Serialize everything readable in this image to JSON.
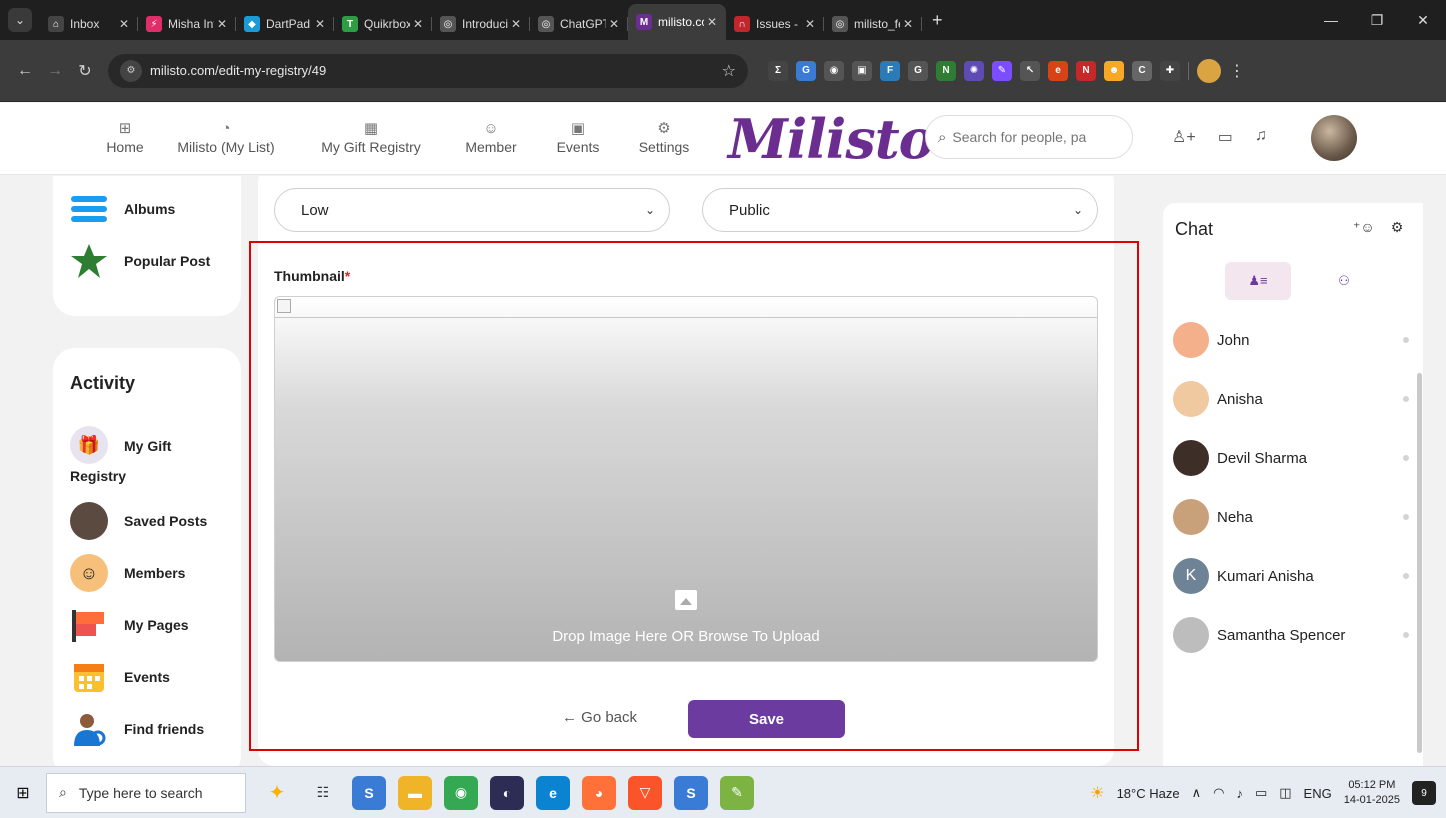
{
  "browser": {
    "tabs": [
      {
        "label": "Inbox",
        "icon": "inbox-icon",
        "color": "#444444",
        "glyph": "⌂"
      },
      {
        "label": "Misha Inf",
        "icon": "misha-icon",
        "color": "#e02e6a",
        "glyph": "⚡"
      },
      {
        "label": "DartPad",
        "icon": "dartpad-icon",
        "color": "#1a9ad6",
        "glyph": "◆"
      },
      {
        "label": "Quikrbox",
        "icon": "quikrbox-icon",
        "color": "#2e9e44",
        "glyph": "T"
      },
      {
        "label": "Introducir",
        "icon": "openai-icon",
        "color": "#555555",
        "glyph": "◎"
      },
      {
        "label": "ChatGPT",
        "icon": "chatgpt-icon",
        "color": "#555555",
        "glyph": "◎"
      },
      {
        "label": "milisto.co",
        "icon": "milisto-icon",
        "color": "#6b2d8f",
        "glyph": "M",
        "active": true
      },
      {
        "label": "Issues - M",
        "icon": "issues-icon",
        "color": "#c0262d",
        "glyph": "∩"
      },
      {
        "label": "milisto_fe",
        "icon": "github-icon",
        "color": "#555555",
        "glyph": "◎"
      }
    ],
    "url": "milisto.com/edit-my-registry/49"
  },
  "header": {
    "nav": [
      {
        "label": "Home",
        "icon": "home-grid-icon",
        "glyph": "⊞"
      },
      {
        "label": "Milisto (My List)",
        "icon": "pie-chart-icon",
        "glyph": "◔"
      },
      {
        "label": "My Gift Registry",
        "icon": "registry-grid-icon",
        "glyph": "▦"
      },
      {
        "label": "Member",
        "icon": "chat-bubble-icon",
        "glyph": "☺"
      },
      {
        "label": "Events",
        "icon": "calendar-icon",
        "glyph": "▣"
      },
      {
        "label": "Settings",
        "icon": "settings-gear-icon",
        "glyph": "⚙"
      }
    ],
    "logo": "Milisto",
    "search_placeholder": "Search for people, pa"
  },
  "sidebar": {
    "top_items": [
      {
        "label": "Albums",
        "icon": "albums-icon"
      },
      {
        "label": "Popular Post",
        "icon": "star-icon"
      }
    ],
    "activity_title": "Activity",
    "activity_items": [
      {
        "label": "My Gift",
        "label2": "Registry",
        "icon": "gift-registry-icon"
      },
      {
        "label": "Saved Posts",
        "icon": "saved-posts-icon"
      },
      {
        "label": "Members",
        "icon": "members-icon"
      },
      {
        "label": "My Pages",
        "icon": "my-pages-icon"
      },
      {
        "label": "Events",
        "icon": "events-calendar-icon"
      },
      {
        "label": "Find friends",
        "icon": "find-friends-icon"
      }
    ]
  },
  "form": {
    "priority_value": "Low",
    "visibility_value": "Public",
    "thumbnail_label": "Thumbnail",
    "required_mark": "*",
    "drop_text": "Drop Image Here OR Browse To Upload",
    "go_back": "← Go back",
    "save": "Save"
  },
  "chat": {
    "title": "Chat",
    "contacts": [
      {
        "name": "John",
        "color": "#f3b08a",
        "initial": ""
      },
      {
        "name": "Anisha",
        "color": "#f0c9a0",
        "initial": ""
      },
      {
        "name": "Devil Sharma",
        "color": "#3d2f28",
        "initial": ""
      },
      {
        "name": "Neha",
        "color": "#c8a07a",
        "initial": ""
      },
      {
        "name": "Kumari Anisha",
        "color": "#6f8397",
        "initial": "K"
      },
      {
        "name": "Samantha Spencer",
        "color": "#bdbdbd",
        "initial": ""
      }
    ]
  },
  "taskbar": {
    "search_placeholder": "Type here to search",
    "weather": "18°C Haze",
    "language": "ENG",
    "time": "05:12 PM",
    "date": "14-01-2025",
    "notifications": "9"
  }
}
